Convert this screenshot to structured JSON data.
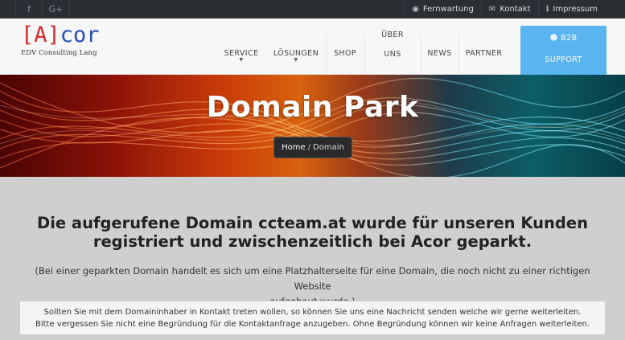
{
  "topbar": {
    "social": [
      {
        "icon": "facebook-icon",
        "glyph": "f"
      },
      {
        "icon": "google-plus-icon",
        "glyph": "G+"
      }
    ],
    "links": [
      {
        "label": "Fernwartung",
        "icon": "globe-icon",
        "glyph": "◉"
      },
      {
        "label": "Kontakt",
        "icon": "envelope-icon",
        "glyph": "✉"
      },
      {
        "label": "Impressum",
        "icon": "info-icon",
        "glyph": "ℹ"
      }
    ]
  },
  "logo": {
    "bracket_open": "[",
    "letter": "A",
    "bracket_close": "]",
    "rest": "cor",
    "subtitle": "EDV Consulting Lang"
  },
  "nav": {
    "items": [
      {
        "label": "SERVICE",
        "has_dropdown": true
      },
      {
        "label": "LÖSUNGEN",
        "has_dropdown": true
      },
      {
        "label": "SHOP",
        "has_dropdown": false
      },
      {
        "label_line1": "ÜBER",
        "label_line2": "UNS",
        "has_dropdown": false
      },
      {
        "label": "NEWS",
        "has_dropdown": false
      },
      {
        "label": "PARTNER",
        "has_dropdown": false
      }
    ],
    "b2b": {
      "line1": "B2B",
      "line2": "SUPPORT",
      "icon": "user-icon"
    }
  },
  "banner": {
    "title": "Domain Park",
    "breadcrumb": {
      "home": "Home",
      "separator": "/",
      "current": "Domain"
    }
  },
  "content": {
    "headline_line1": "Die aufgerufene Domain ccteam.at wurde für unseren Kunden",
    "headline_line2": "registriert und zwischenzeitlich bei Acor geparkt.",
    "note_line1": "(Bei einer geparkten Domain handelt es sich um eine Platzhalterseite für eine Domain, die noch nicht zu einer richtigen Website",
    "note_line2": "aufgebaut wurde.)",
    "info_line1": "Sollten Sie mit dem Domaininhaber in Kontakt treten wollen, so können Sie uns eine Nachricht senden welche wir gerne weiterleiten.",
    "info_line2": "Bitte vergessen Sie nicht eine Begründung für die Kontaktanfrage anzugeben. Ohne Begründung können wir keine Anfragen weiterleiten."
  },
  "colors": {
    "topbar_bg": "#2b2e33",
    "accent_blue": "#5ab4f0",
    "logo_blue": "#2a4db5",
    "logo_red": "#d42b2b",
    "page_bg": "#cfcfcf"
  }
}
